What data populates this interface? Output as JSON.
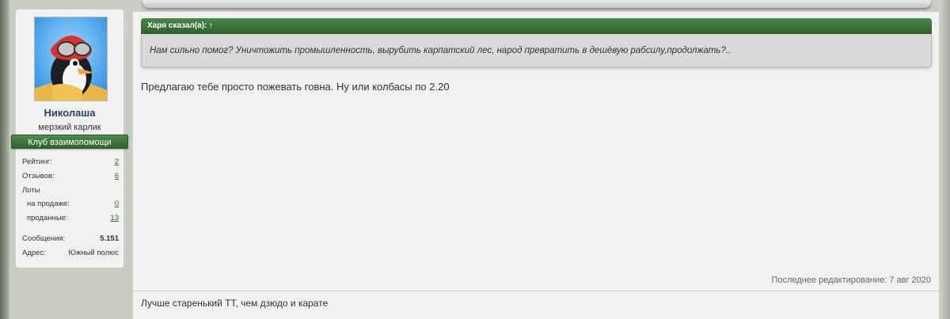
{
  "user": {
    "name": "Николаша",
    "title": "мерзкий карлик",
    "banner": "Клуб взаимопомощи",
    "stats": [
      {
        "label": "Рейтинг:",
        "value": "2",
        "link": true
      },
      {
        "label": "Отзывов:",
        "value": "6",
        "link": true
      },
      {
        "label": "Лоты",
        "value": ""
      },
      {
        "label": "на продаже:",
        "value": "0",
        "link": true,
        "indent": true
      },
      {
        "label": "проданные:",
        "value": "13",
        "link": true,
        "indent": true
      },
      {
        "label": "Сообщения:",
        "value": "5.151",
        "bold": true
      },
      {
        "label": "Адрес:",
        "value": "Южный полюс"
      }
    ]
  },
  "post": {
    "quote_header": "Харя сказал(а): ↑",
    "quote_text": "Нам сильно помог? Уничтожить промышленность, вырубить карпатский лес, народ превратить в дешёвую рабсилу,продолжать?..",
    "message": "Предлагаю тебе просто пожевать говна. Ну или колбасы по 2.20",
    "edited": "Последнее редактирование: 7 авг 2020",
    "signature": "Лучше старенький ТТ, чем дзюдо и карате"
  },
  "colors": {
    "accent_green": "#2c5f2c",
    "username_blue": "#2d3e6a",
    "link_green": "#2f6a2f"
  }
}
